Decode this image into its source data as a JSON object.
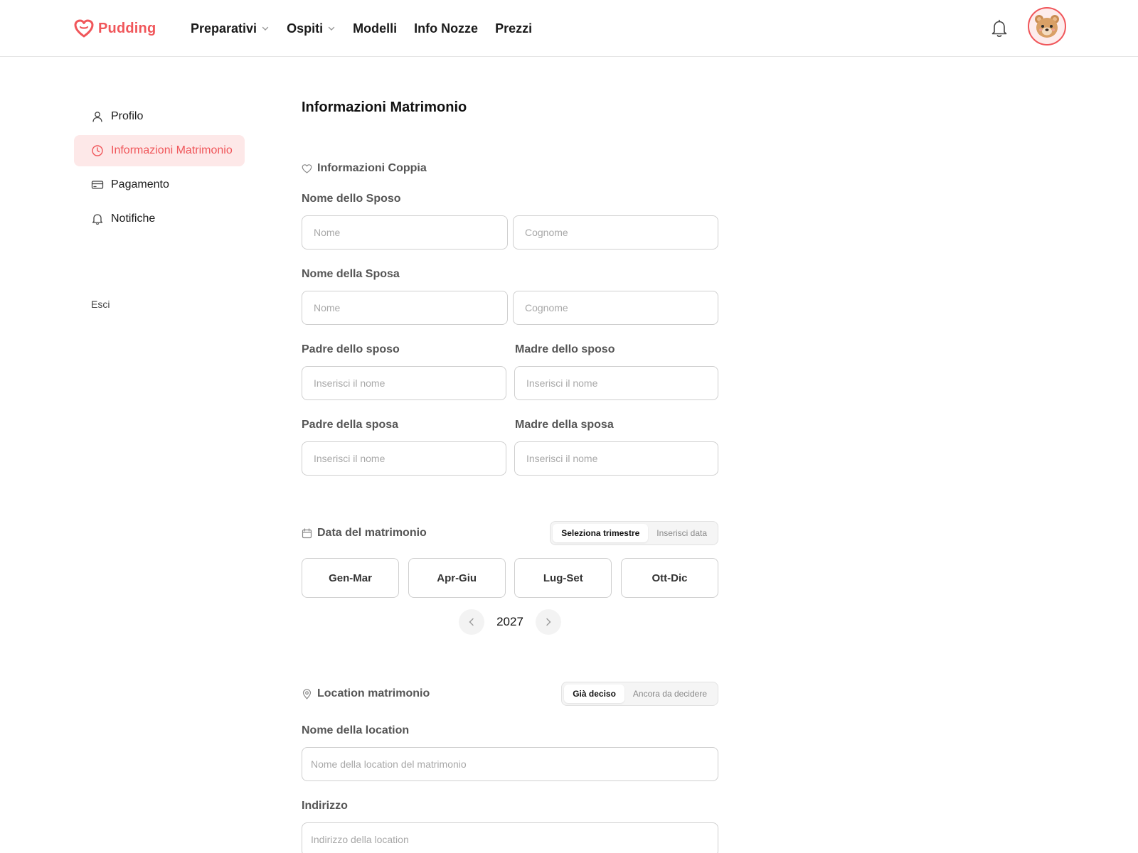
{
  "brand": {
    "name": "Pudding",
    "accent": "#f0565a"
  },
  "nav": {
    "items": [
      {
        "label": "Preparativi",
        "dropdown": true
      },
      {
        "label": "Ospiti",
        "dropdown": true
      },
      {
        "label": "Modelli",
        "dropdown": false
      },
      {
        "label": "Info Nozze",
        "dropdown": false
      },
      {
        "label": "Prezzi",
        "dropdown": false
      }
    ],
    "icons": {
      "notifications": "bell-icon",
      "avatar": "bear-avatar"
    }
  },
  "sidebar": {
    "items": [
      {
        "label": "Profilo",
        "icon": "user-icon",
        "active": false
      },
      {
        "label": "Informazioni Matrimonio",
        "icon": "clock-icon",
        "active": true
      },
      {
        "label": "Pagamento",
        "icon": "card-icon",
        "active": false
      },
      {
        "label": "Notifiche",
        "icon": "bell-icon",
        "active": false
      }
    ],
    "logout_label": "Esci"
  },
  "main": {
    "title": "Informazioni Matrimonio",
    "couple": {
      "section_title": "Informazioni Coppia",
      "groom_label": "Nome dello Sposo",
      "bride_label": "Nome della Sposa",
      "first_name_placeholder": "Nome",
      "last_name_placeholder": "Cognome",
      "groom_father_label": "Padre dello sposo",
      "groom_mother_label": "Madre dello sposo",
      "bride_father_label": "Padre della sposa",
      "bride_mother_label": "Madre della sposa",
      "name_placeholder": "Inserisci il nome"
    },
    "date": {
      "section_title": "Data del matrimonio",
      "toggle": [
        "Seleziona trimestre",
        "Inserisci data"
      ],
      "selected_toggle": "Seleziona trimestre",
      "quarters": [
        "Gen-Mar",
        "Apr-Giu",
        "Lug-Set",
        "Ott-Dic"
      ],
      "year": "2027"
    },
    "location": {
      "section_title": "Location matrimonio",
      "toggle": [
        "Già deciso",
        "Ancora da decidere"
      ],
      "selected_toggle": "Già deciso",
      "name_label": "Nome della location",
      "name_placeholder": "Nome della location del matrimonio",
      "address_label": "Indirizzo",
      "address_placeholder": "Indirizzo della location"
    }
  }
}
